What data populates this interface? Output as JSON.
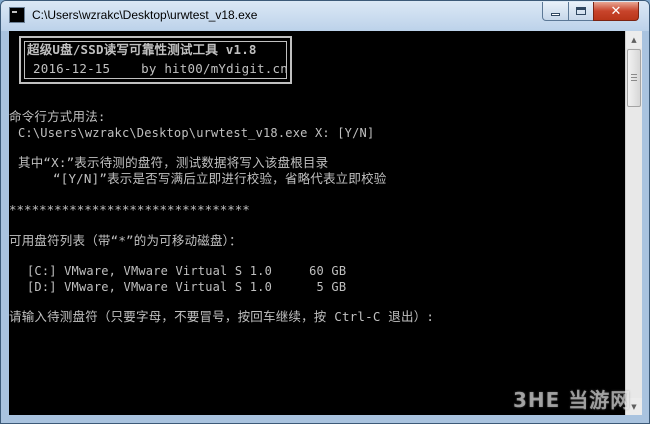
{
  "window": {
    "title": "C:\\Users\\wzrakc\\Desktop\\urwtest_v18.exe",
    "icon": "console-icon",
    "colors": {
      "console_bg": "#000000",
      "console_text": "#c0c0c0",
      "close_button": "#c8442b"
    }
  },
  "console": {
    "banner": {
      "line1": "超级U盘/SSD读写可靠性测试工具 v1.8",
      "line2": "2016-12-15    by hit00/mYdigit.cn"
    },
    "usage_heading": "命令行方式用法:",
    "usage_command": "C:\\Users\\wzrakc\\Desktop\\urwtest_v18.exe X: [Y/N]",
    "explain_x": "其中“X:”表示待测的盘符，测试数据将写入该盘根目录",
    "explain_yn": "“[Y/N]”表示是否写满后立即进行校验，省略代表立即校验",
    "separator": "********************************",
    "drive_list_heading": "可用盘符列表（带“*”的为可移动磁盘）：",
    "drives": [
      "[C:] VMware, VMware Virtual S 1.0     60 GB",
      "[D:] VMware, VMware Virtual S 1.0      5 GB"
    ],
    "prompt": "请输入待测盘符（只要字母，不要冒号，按回车继续，按 Ctrl-C 退出）:"
  },
  "watermark": "3HE 当游网"
}
